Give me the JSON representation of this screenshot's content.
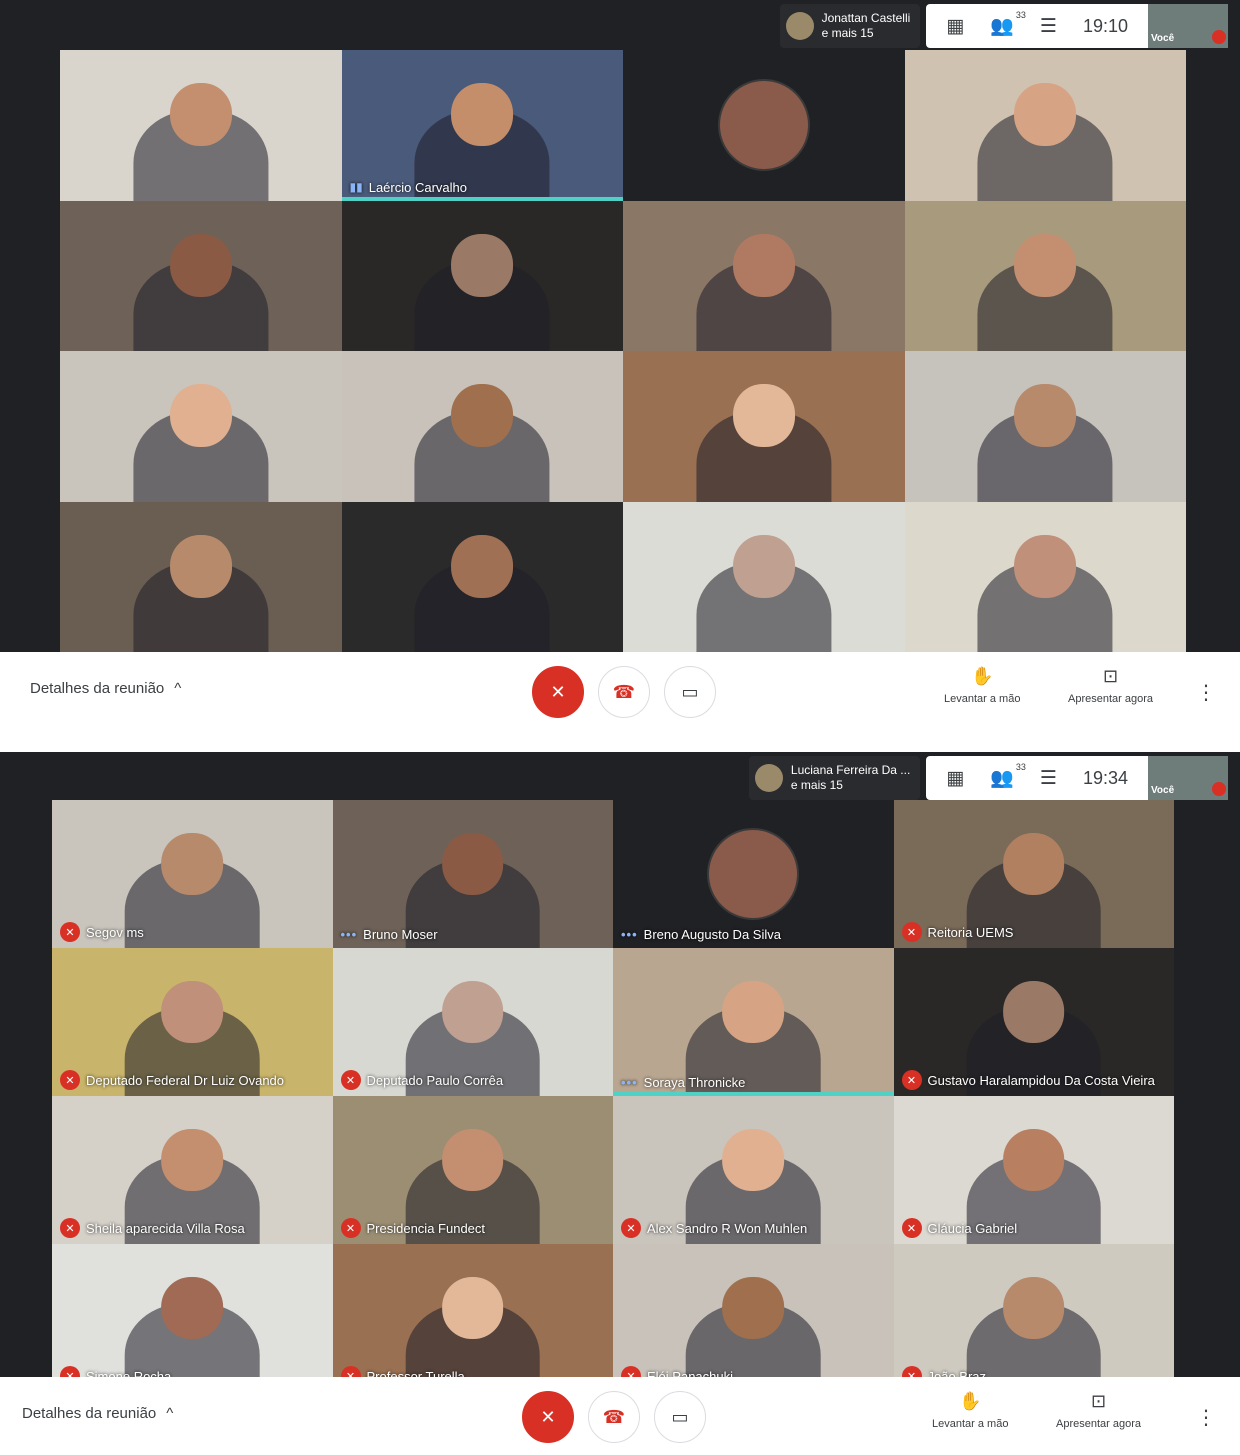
{
  "shot1": {
    "presenter": {
      "line1": "Jonattan Castelli",
      "line2": "e mais 15"
    },
    "participants_count": "33",
    "time": "19:10",
    "self_label": "Você",
    "tiles": [
      {
        "label": "",
        "bg": "#d9d4cc",
        "head": "#c48f6e"
      },
      {
        "label": "Laércio Carvalho",
        "bg": "#4a5a7a",
        "head": "#c58e6a",
        "speaking": true
      },
      {
        "label": "",
        "bg": "#202124",
        "avatar": true
      },
      {
        "label": "",
        "bg": "#cfc2b0",
        "head": "#d6a484"
      },
      {
        "label": "",
        "bg": "#6e6258",
        "head": "#8a5a44"
      },
      {
        "label": "",
        "bg": "#2a2826",
        "head": "#9a7a66"
      },
      {
        "label": "",
        "bg": "#8a7766",
        "head": "#b07a62"
      },
      {
        "label": "",
        "bg": "#a89a7c",
        "head": "#c48e70"
      },
      {
        "label": "",
        "bg": "#c9c4bc",
        "head": "#e0b090"
      },
      {
        "label": "",
        "bg": "#c8c2ba",
        "head": "#a0704e"
      },
      {
        "label": "",
        "bg": "#9a7052",
        "head": "#e2b898"
      },
      {
        "label": "",
        "bg": "#c6c2bc",
        "head": "#b88a6c"
      },
      {
        "label": "",
        "bg": "#6a5e52",
        "head": "#b88a6c"
      },
      {
        "label": "",
        "bg": "#2a2a2a",
        "head": "#a07054"
      },
      {
        "label": "",
        "bg": "#dcdcd6",
        "head": "#c0a090"
      },
      {
        "label": "",
        "bg": "#dcd8cc",
        "head": "#c0907a"
      }
    ]
  },
  "shot2": {
    "presenter": {
      "line1": "Luciana Ferreira Da ...",
      "line2": "e mais 15"
    },
    "participants_count": "33",
    "time": "19:34",
    "self_label": "Você",
    "tiles": [
      {
        "label": "Segov ms",
        "muted": true,
        "bg": "#c9c4bc",
        "head": "#b88a6c"
      },
      {
        "label": "Bruno Moser",
        "dots": true,
        "bg": "#6e6258",
        "head": "#8a5a44"
      },
      {
        "label": "Breno Augusto Da Silva",
        "dots": true,
        "bg": "#202124",
        "avatar": true
      },
      {
        "label": "Reitoria UEMS",
        "muted": true,
        "bg": "#7a6a58",
        "head": "#b08060"
      },
      {
        "label": "Deputado Federal Dr Luiz Ovando",
        "muted": true,
        "bg": "#c8b46a",
        "head": "#c0907a"
      },
      {
        "label": "Deputado Paulo Corrêa",
        "muted": true,
        "bg": "#d8d8d2",
        "head": "#c0a090"
      },
      {
        "label": "Soraya Thronicke",
        "dots": true,
        "speaking": true,
        "bg": "#b8a690",
        "head": "#d6a484"
      },
      {
        "label": "Gustavo Haralampidou Da Costa Vieira",
        "muted": true,
        "bg": "#2a2826",
        "head": "#9a7a66"
      },
      {
        "label": "Sheila aparecida Villa Rosa",
        "muted": true,
        "bg": "#d5d0c8",
        "head": "#c48f6e"
      },
      {
        "label": "Presidencia Fundect",
        "muted": true,
        "bg": "#9c8e72",
        "head": "#c48e70"
      },
      {
        "label": "Alex Sandro R Won Muhlen",
        "muted": true,
        "bg": "#c9c4bc",
        "head": "#e0b090"
      },
      {
        "label": "Gláucia Gabriel",
        "muted": true,
        "bg": "#dcd8d2",
        "head": "#b88060"
      },
      {
        "label": "Simone Rocha",
        "muted": true,
        "bg": "#e0e0dc",
        "head": "#a06a54"
      },
      {
        "label": "Professor Turella",
        "muted": true,
        "bg": "#9a7052",
        "head": "#e2b898"
      },
      {
        "label": "Elói Panachuki",
        "muted": true,
        "bg": "#c8c2ba",
        "head": "#a0704e"
      },
      {
        "label": "João Braz",
        "muted": true,
        "bg": "#cfcac0",
        "head": "#b88a6c"
      }
    ]
  },
  "bottom": {
    "details": "Detalhes da reunião",
    "raise_hand": "Levantar a mão",
    "present": "Apresentar agora"
  },
  "icons": [
    "layout-icon",
    "people-icon",
    "chat-icon",
    "mic-off-icon",
    "hangup-icon",
    "camera-icon",
    "hand-icon",
    "present-icon",
    "more-icon",
    "chevron-up-icon"
  ],
  "colors": {
    "mute": "#d93025",
    "active_speaker": "#4fd1c5",
    "dark": "#202124"
  }
}
